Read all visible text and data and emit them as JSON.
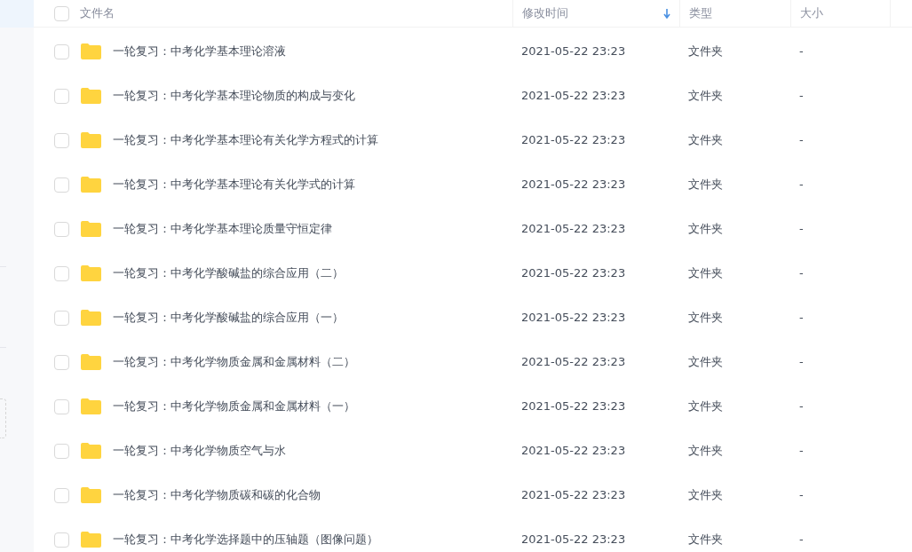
{
  "header": {
    "checked": false,
    "columns": [
      {
        "label": "文件名",
        "sorted": false
      },
      {
        "label": "修改时间",
        "sorted": true
      },
      {
        "label": "类型",
        "sorted": false
      },
      {
        "label": "大小",
        "sorted": false
      }
    ]
  },
  "rows": [
    {
      "name": "一轮复习：中考化学基本理论溶液",
      "modified": "2021-05-22 23:23",
      "type": "文件夹",
      "size": "-",
      "checked": false
    },
    {
      "name": "一轮复习：中考化学基本理论物质的构成与变化",
      "modified": "2021-05-22 23:23",
      "type": "文件夹",
      "size": "-",
      "checked": false
    },
    {
      "name": "一轮复习：中考化学基本理论有关化学方程式的计算",
      "modified": "2021-05-22 23:23",
      "type": "文件夹",
      "size": "-",
      "checked": false
    },
    {
      "name": "一轮复习：中考化学基本理论有关化学式的计算",
      "modified": "2021-05-22 23:23",
      "type": "文件夹",
      "size": "-",
      "checked": false
    },
    {
      "name": "一轮复习：中考化学基本理论质量守恒定律",
      "modified": "2021-05-22 23:23",
      "type": "文件夹",
      "size": "-",
      "checked": false
    },
    {
      "name": "一轮复习：中考化学酸碱盐的综合应用（二）",
      "modified": "2021-05-22 23:23",
      "type": "文件夹",
      "size": "-",
      "checked": false
    },
    {
      "name": "一轮复习：中考化学酸碱盐的综合应用（一）",
      "modified": "2021-05-22 23:23",
      "type": "文件夹",
      "size": "-",
      "checked": false
    },
    {
      "name": "一轮复习：中考化学物质金属和金属材料（二）",
      "modified": "2021-05-22 23:23",
      "type": "文件夹",
      "size": "-",
      "checked": false
    },
    {
      "name": "一轮复习：中考化学物质金属和金属材料（一）",
      "modified": "2021-05-22 23:23",
      "type": "文件夹",
      "size": "-",
      "checked": false
    },
    {
      "name": "一轮复习：中考化学物质空气与水",
      "modified": "2021-05-22 23:23",
      "type": "文件夹",
      "size": "-",
      "checked": false
    },
    {
      "name": "一轮复习：中考化学物质碳和碳的化合物",
      "modified": "2021-05-22 23:23",
      "type": "文件夹",
      "size": "-",
      "checked": false
    },
    {
      "name": "一轮复习：中考化学选择题中的压轴题（图像问题）",
      "modified": "2021-05-22 23:23",
      "type": "文件夹",
      "size": "-",
      "checked": false
    }
  ]
}
